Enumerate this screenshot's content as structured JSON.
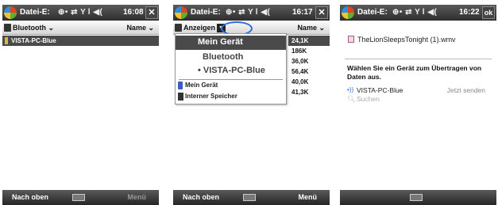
{
  "status_icons": "⊕• ⇄ Y l ◀(",
  "screens": [
    {
      "title": "Datei-E:",
      "time": "16:08",
      "close": "✕",
      "header_left": "Bluetooth ⌄",
      "header_right": "Name ⌄",
      "selected_item": "VISTA-PC-Blue",
      "soft_left": "Nach oben",
      "soft_right": "Menü"
    },
    {
      "title": "Datei-E:",
      "time": "16:17",
      "close": "✕",
      "header_left": "Anzeigen",
      "header_right": "Name ⌄",
      "menu": {
        "selected": "Mein Gerät",
        "bluetooth": "Bluetooth",
        "pc": "• VISTA-PC-Blue",
        "device": "Mein Gerät",
        "internal": "Interner Speicher"
      },
      "sizes": [
        "24,1K",
        "186K",
        "36,0K",
        "56,4K",
        "40,0K",
        "41,3K"
      ],
      "soft_left": "Nach oben",
      "soft_right": "Menü"
    },
    {
      "title": "Datei-E:",
      "time": "16:22",
      "ok": "ok",
      "file": "TheLionSleepsTonight (1).wmv",
      "choose": "Wählen Sie ein Gerät zum Übertragen von Daten aus.",
      "device": "VISTA-PC-Blue",
      "send": "Jetzt senden",
      "search": "Suchen"
    }
  ],
  "icons": {
    "start": "windows-logo-icon",
    "keyboard": "keyboard-icon",
    "dropdown": "▼"
  },
  "colors": {
    "titlebar": "#3a3a3a",
    "selection": "#4a4a4a",
    "highlight_ring": "#2f6fd6"
  }
}
